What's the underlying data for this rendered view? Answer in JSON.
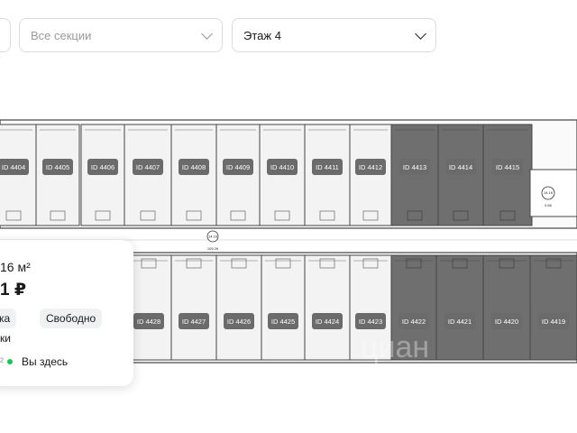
{
  "filters": {
    "sections_placeholder": "Все секции",
    "floor_value": "Этаж 4"
  },
  "plan": {
    "top_units": [
      "ID 4404",
      "ID 4405",
      "ID 4406",
      "ID 4407",
      "ID 4408",
      "ID 4409",
      "ID 4410",
      "ID 4411",
      "ID 4412",
      "ID 4413",
      "ID 4414",
      "ID 4415"
    ],
    "bottom_units": [
      "ID 4428",
      "ID 4427",
      "ID 4426",
      "ID 4425",
      "ID 4424",
      "ID 4423",
      "ID 4422",
      "ID 4421",
      "ID 4420",
      "ID 4419"
    ],
    "dark_top_from_index": 9,
    "dark_bottom_from_index": 6,
    "corridor_marker": "14.16",
    "corridor_marker_sub": "109.26",
    "stair_marker": "14.16",
    "stair_marker_sub": "0.56",
    "watermark": "циан",
    "colors": {
      "light_fill": "#f3f3f3",
      "dark_fill": "#6f6f6f",
      "label_bg": "#6b6b6b",
      "label_text": "#ffffff"
    }
  },
  "popup": {
    "area": "16 м²",
    "price": "1 ₽",
    "chip_left": "ка",
    "chip_status": "Свободно",
    "line3": "ки",
    "line4_prefix": "²",
    "you_are_here": "Вы здесь",
    "dot_color": "#1fbf5a"
  }
}
